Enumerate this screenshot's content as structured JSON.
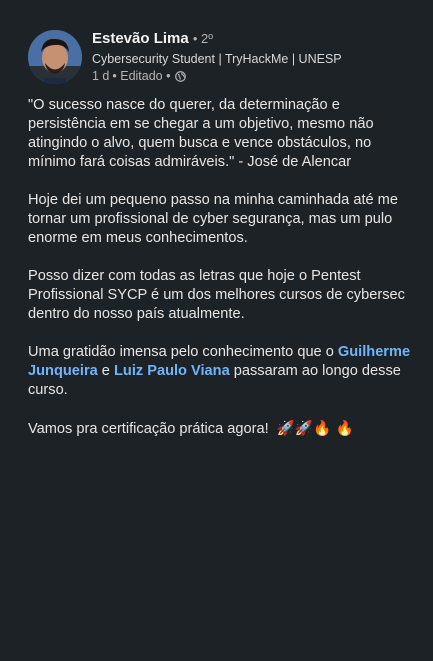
{
  "author": {
    "name": "Estevão Lima",
    "degree": "• 2º",
    "headline": "Cybersecurity Student | TryHackMe | UNESP",
    "time": "1 d",
    "edited": "• Editado •"
  },
  "post": {
    "quote": "\"O sucesso nasce do querer, da determinação e\npersistência em se chegar a um objetivo, mesmo não\natingindo o alvo, quem busca e vence obstáculos, no\nmínimo fará coisas admiráveis.\" - José de Alencar",
    "p2": "Hoje dei um pequeno passo na minha caminhada até me\ntornar um profissional de cyber segurança, mas um pulo\nenorme em meus conhecimentos.",
    "p3": "Posso dizer com todas as letras que hoje o Pentest\nProfissional  SYCP é um dos melhores cursos de cybersec\ndentro do nosso país atualmente.",
    "p4_before": "Uma gratidão imensa pelo conhecimento que o ",
    "mention1": "Guilherme\nJunqueira",
    "p4_and": " e ",
    "mention2": "Luiz Paulo Viana",
    "p4_after": " passaram ao longo desse\ncurso.",
    "p5": "Vamos pra certificação prática agora!",
    "emojis": "🚀🚀🔥 🔥"
  },
  "colors": {
    "background": "#1d2226",
    "mention": "#70b5f9"
  },
  "icons": {
    "visibility": "globe-icon"
  }
}
